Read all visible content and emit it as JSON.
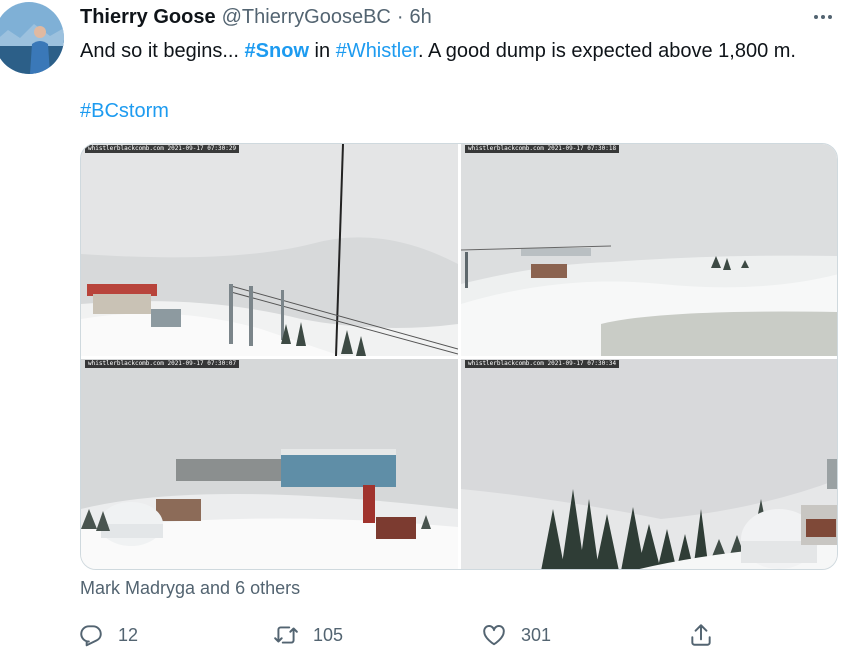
{
  "author": {
    "name": "Thierry Goose",
    "handle": "@ThierryGooseBC",
    "separator": "·",
    "time": "6h"
  },
  "tweet": {
    "part1": "And so it begins... ",
    "hashtag_snow": "#Snow",
    "part2": " in ",
    "hashtag_whistler": "#Whistler",
    "part3": ". A good dump is expected above 1,800 m.",
    "hashtag_bcstorm": "#BCstorm"
  },
  "images": [
    {
      "stamp": "whistlerblackcomb.com  2021-09-17 07:30:29",
      "icon": "webcam-chairlift-tower"
    },
    {
      "stamp": "whistlerblackcomb.com  2021-09-17 07:30:18",
      "icon": "webcam-snowy-ridge"
    },
    {
      "stamp": "whistlerblackcomb.com  2021-09-17 07:30:07",
      "icon": "webcam-lodge-village"
    },
    {
      "stamp": "whistlerblackcomb.com  2021-09-17 07:30:34",
      "icon": "webcam-snowy-trees"
    }
  ],
  "social": {
    "likers": "Mark Madryga and 6 others"
  },
  "actions": {
    "reply_count": "12",
    "retweet_count": "105",
    "like_count": "301"
  },
  "colors": {
    "accent": "#1d9bf0",
    "secondary_text": "#536471",
    "primary_text": "#0f1419"
  }
}
